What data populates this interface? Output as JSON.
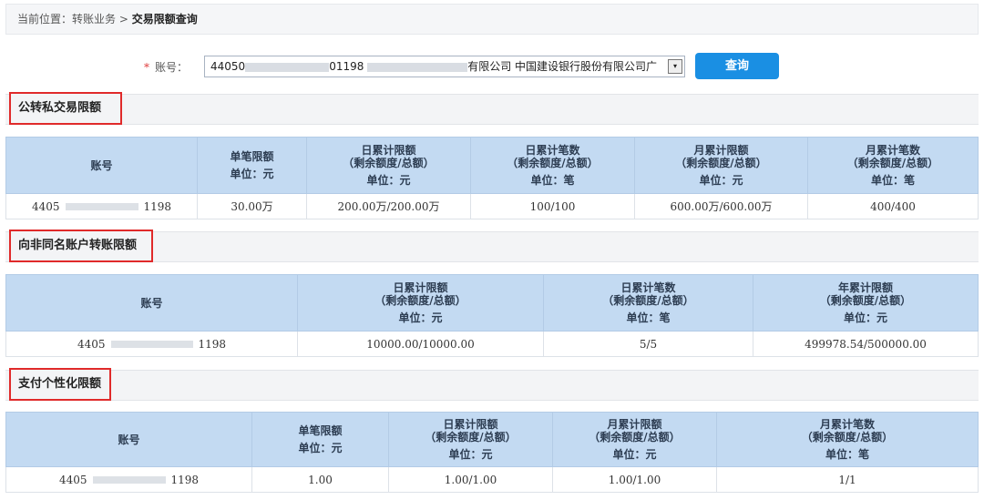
{
  "breadcrumb": {
    "prefix": "当前位置：转账业务 > ",
    "current": "交易限额查询"
  },
  "account_field": {
    "label": "账号：",
    "value_start": "44050",
    "value_mid": "01198",
    "value_end": "有限公司 中国建设银行股份有限公司广",
    "arrow": "▾"
  },
  "query_button": "查询",
  "sections": [
    {
      "title": "公转私交易限额",
      "headers": {
        "account": "账号",
        "single": [
          "单笔限额",
          "单位：元"
        ],
        "daily_amount": [
          "日累计限额",
          "（剩余额度/总额）",
          "单位：元"
        ],
        "daily_count": [
          "日累计笔数",
          "（剩余额度/总额）",
          "单位：笔"
        ],
        "monthly_amount": [
          "月累计限额",
          "（剩余额度/总额）",
          "单位：元"
        ],
        "monthly_count": [
          "月累计笔数",
          "（剩余额度/总额）",
          "单位：笔"
        ]
      },
      "row": {
        "account_start": "4405",
        "account_end": "1198",
        "single": "30.00万",
        "daily_amount": "200.00万/200.00万",
        "daily_count": "100/100",
        "monthly_amount": "600.00万/600.00万",
        "monthly_count": "400/400"
      }
    },
    {
      "title": "向非同名账户转账限额",
      "headers": {
        "account": "账号",
        "daily_amount": [
          "日累计限额",
          "（剩余额度/总额）",
          "单位：元"
        ],
        "daily_count": [
          "日累计笔数",
          "（剩余额度/总额）",
          "单位：笔"
        ],
        "yearly_amount": [
          "年累计限额",
          "（剩余额度/总额）",
          "单位：元"
        ]
      },
      "row": {
        "account_start": "4405",
        "account_end": "1198",
        "daily_amount": "10000.00/10000.00",
        "daily_count": "5/5",
        "yearly_amount": "499978.54/500000.00"
      }
    },
    {
      "title": "支付个性化限额",
      "headers": {
        "account": "账号",
        "single": [
          "单笔限额",
          "单位：元"
        ],
        "daily_amount": [
          "日累计限额",
          "（剩余额度/总额）",
          "单位：元"
        ],
        "monthly_amount": [
          "月累计限额",
          "（剩余额度/总额）",
          "单位：元"
        ],
        "monthly_count": [
          "月累计笔数",
          "（剩余额度/总额）",
          "单位：笔"
        ]
      },
      "row": {
        "account_start": "4405",
        "account_end": "1198",
        "single": "1.00",
        "daily_amount": "1.00/1.00",
        "monthly_amount": "1.00/1.00",
        "monthly_count": "1/1"
      }
    }
  ]
}
